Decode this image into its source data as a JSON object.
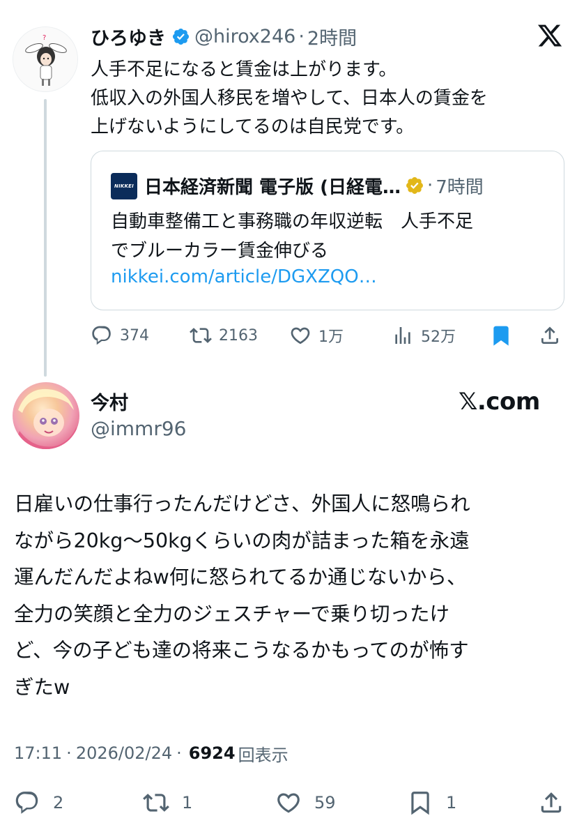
{
  "quoted_tweet": {
    "author_name": "ひろゆき",
    "handle": "@hirox246",
    "separator": "·",
    "time_ago": "2時間",
    "lines": [
      "人手不足になると賃金は上がります。",
      "低収入の外国人移民を増やして、日本人の賃金を",
      "上げないようにしてるのは自民党です。"
    ],
    "card": {
      "logo_text": "NIKKEI",
      "source_name": "日本経済新聞 電子版 (日経電…",
      "separator": "·",
      "time_ago": "7時間",
      "lines": [
        "自動車整備工と事務職の年収逆転　人手不足",
        "でブルーカラー賃金伸びる"
      ],
      "link": "nikkei.com/article/DGXZQO…"
    },
    "actions": {
      "replies": "374",
      "retweets": "2163",
      "likes": "1万",
      "views": "52万"
    }
  },
  "main_tweet": {
    "author_name": "今村",
    "handle": "@immr96",
    "brand": "𝕏.com",
    "lines": [
      "日雇いの仕事行ったんだけどさ、外国人に怒鳴られ",
      "ながら20kg〜50kgくらいの肉が詰まった箱を永遠",
      "運んだんだよねw何に怒られてるか通じないから、",
      "全力の笑顔と全力のジェスチャーで乗り切ったけ",
      "ど、今の子ども達の将来こうなるかもってのが怖す",
      "ぎたw"
    ],
    "meta": {
      "time": "17:11",
      "separator": "·",
      "date": "2026/02/24",
      "separator2": "·",
      "views": "6924",
      "views_label": "回表示"
    },
    "actions": {
      "replies": "2",
      "retweets": "1",
      "likes": "59",
      "bookmarks": "1"
    }
  },
  "colors": {
    "text": "#0f1419",
    "secondary": "#536471",
    "link": "#1d9bf0",
    "border": "#cfd9de",
    "verified_blue": "#1d9bf0",
    "verified_gold": "#e2b719",
    "nikkei_navy": "#0b2c5a"
  },
  "icons": [
    "reply-icon",
    "retweet-icon",
    "like-icon",
    "views-icon",
    "bookmark-icon",
    "share-icon",
    "verified-badge-icon",
    "x-logo-icon"
  ]
}
